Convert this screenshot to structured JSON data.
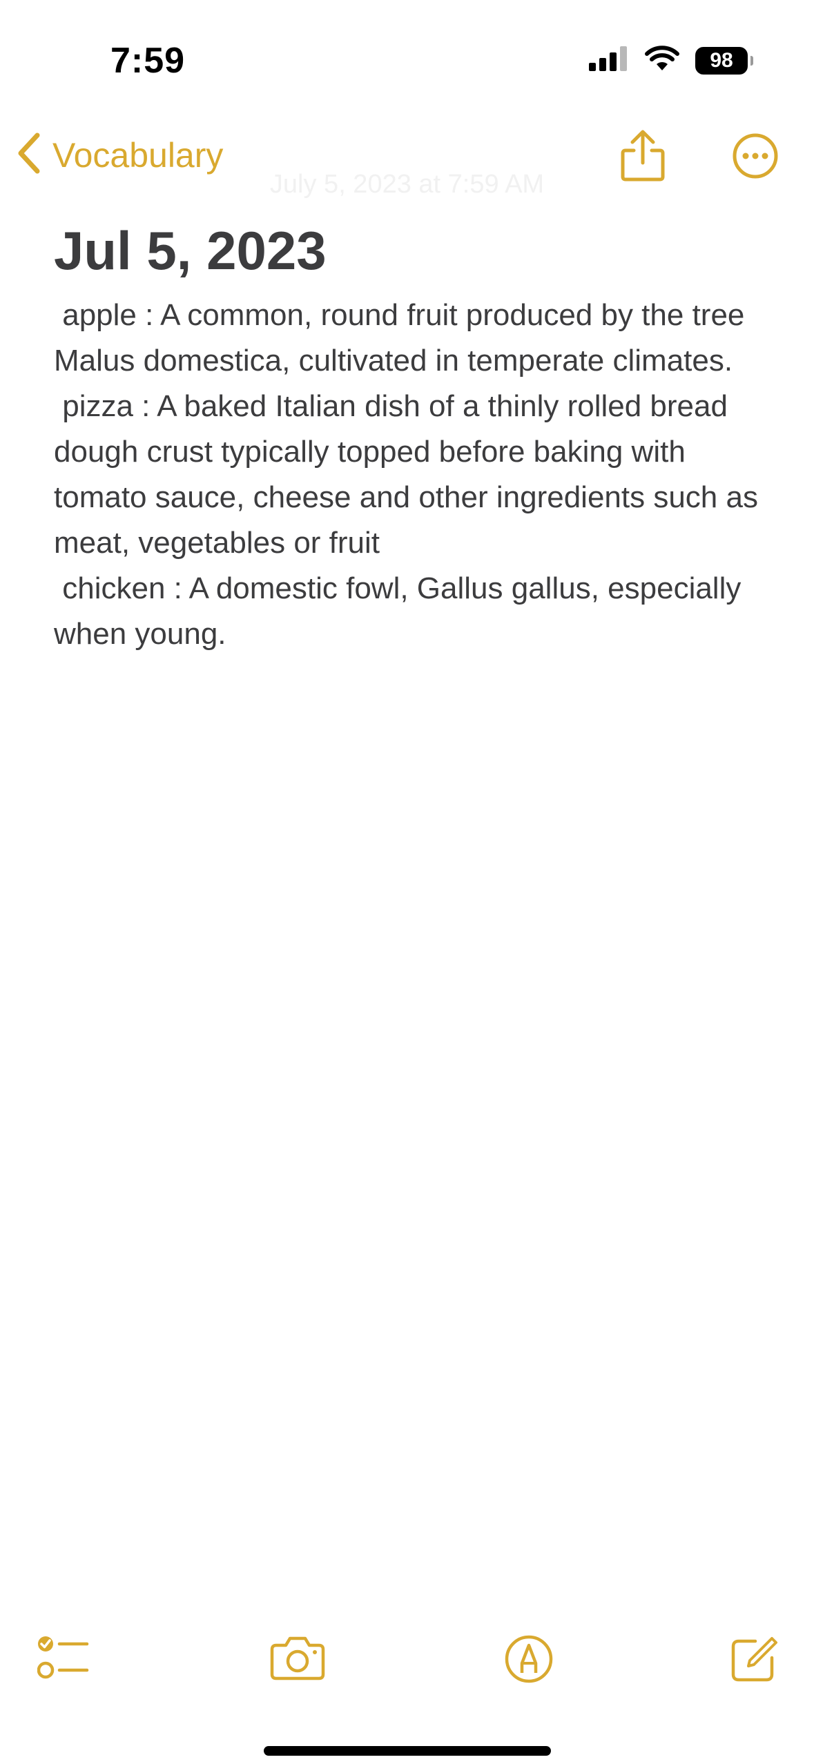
{
  "status_bar": {
    "time": "7:59",
    "battery": "98",
    "icons": [
      "cellular-signal-icon",
      "wifi-icon",
      "battery-icon"
    ]
  },
  "nav": {
    "back_label": "Vocabulary",
    "edited": "July 5, 2023 at 7:59 AM",
    "icons": [
      "chevron-left-icon",
      "share-icon",
      "more-options-icon"
    ]
  },
  "note": {
    "title": "Jul 5, 2023",
    "entries": [
      " apple : A common, round fruit produced by the tree Malus domestica, cultivated in temperate climates.",
      " pizza : A baked Italian dish of a thinly rolled bread dough crust typically topped before baking with tomato sauce, cheese and other ingredients such as meat, vegetables or fruit",
      " chicken : A domestic fowl, Gallus gallus, especially when young."
    ]
  },
  "toolbar": {
    "icons": [
      "checklist-icon",
      "camera-icon",
      "markup-icon",
      "compose-icon"
    ]
  },
  "colors": {
    "accent": "#D9A92F",
    "text": "#3C3C3E",
    "background": "#FFFFFF"
  }
}
